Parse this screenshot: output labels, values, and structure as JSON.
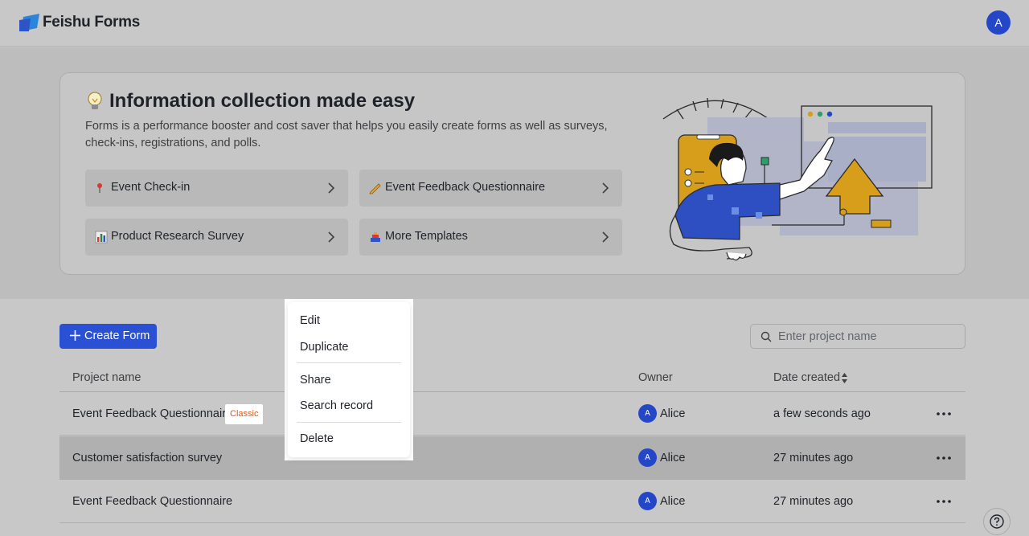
{
  "app": {
    "brand": "Feishu Forms",
    "user_initial": "A"
  },
  "banner": {
    "title": "Information collection made easy",
    "description": "Forms is a performance booster and cost saver that helps you easily create forms as well as surveys, check-ins, registrations, and polls.",
    "templates": [
      {
        "label": "Event Check-in",
        "icon": "pin-icon"
      },
      {
        "label": "Event Feedback Questionnaire",
        "icon": "pencil-icon"
      },
      {
        "label": "Product Research Survey",
        "icon": "bar-chart-icon"
      },
      {
        "label": "More Templates",
        "icon": "templates-icon"
      }
    ]
  },
  "toolbar": {
    "create_label": "Create Form",
    "search_placeholder": "Enter project name"
  },
  "table": {
    "headers": {
      "name": "Project name",
      "owner": "Owner",
      "date": "Date created"
    },
    "rows": [
      {
        "name": "Event Feedback Questionnaire",
        "tag": "Classic",
        "owner_initial": "A",
        "owner": "Alice",
        "date": "a few seconds ago"
      },
      {
        "name": "Customer satisfaction survey",
        "owner_initial": "A",
        "owner": "Alice",
        "date": "27 minutes ago"
      },
      {
        "name": "Event Feedback Questionnaire",
        "owner_initial": "A",
        "owner": "Alice",
        "date": "27 minutes ago"
      }
    ]
  },
  "context_menu": {
    "items": [
      "Edit",
      "Duplicate",
      "Share",
      "Search record",
      "Delete"
    ]
  },
  "colors": {
    "accent": "#2a51d3",
    "avatar": "#2447c7",
    "tag_text": "#d45a1c",
    "illustration_yellow": "#d69e1b"
  }
}
